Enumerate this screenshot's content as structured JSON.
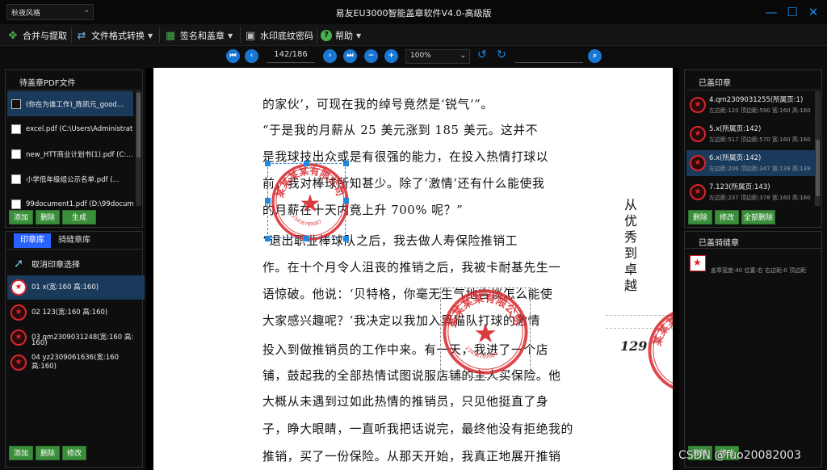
{
  "window": {
    "title": "易友EU3000智能盖章软件V4.0-高级版",
    "theme": "秋夜风格",
    "minimize": "—",
    "maximize": "☐",
    "close": "✕"
  },
  "toolbar": {
    "merge": "合并与提取",
    "convert": "文件格式转换",
    "sign": "签名和盖章",
    "watermark": "水印底纹密码",
    "help": "帮助"
  },
  "nav": {
    "page": "142/186",
    "zoom": "100%",
    "search_placeholder": ""
  },
  "left_panel": {
    "title": "待盖章PDF文件",
    "files": [
      {
        "name": "(你在为谁工作)_陈凯元_good...",
        "checked": false,
        "selected": true
      },
      {
        "name": "excel.pdf (C:\\Users\\Administrat...",
        "checked": false,
        "selected": false
      },
      {
        "name": "new_HTT商业计划书(1).pdf (C:...",
        "checked": false,
        "selected": false
      },
      {
        "name": "小学低年级组公示名单.pdf (...",
        "checked": false,
        "selected": false
      },
      {
        "name": "99document1.pdf (D:\\99docum...",
        "checked": false,
        "selected": false
      }
    ],
    "buttons": {
      "add": "添加",
      "delete": "删除",
      "generate": "生成"
    }
  },
  "stamp_lib": {
    "tabs": [
      "印章库",
      "骑缝章库"
    ],
    "cancel": "取消印章选择",
    "items": [
      {
        "name": "01 x(宽:160 高:160)",
        "selected": true
      },
      {
        "name": "02 123(宽:160 高:160)",
        "selected": false
      },
      {
        "name": "03 qm2309031248(宽:160 高:",
        "name2": "160)",
        "selected": false
      },
      {
        "name": "04 yz2309061636(宽:160 高:160)",
        "selected": false
      }
    ],
    "buttons": {
      "add": "添加",
      "delete": "删除",
      "edit": "修改"
    }
  },
  "document": {
    "lines": [
      "的家伙’，可现在我的绰号竟然是‘锐气’”。",
      "“于是我的月薪从 25 美元涨到 185 美元。这并不",
      "是我球技出众或是有很强的能力，在投入热情打球以",
      "前，我对棒球所知甚少。除了‘激情’还有什么能使我",
      "的月薪在十天内竟上升 700% 呢？”",
      "“退出职业棒球队之后，我去做人寿保险推销工",
      "作。在十个月令人沮丧的推销之后，我被卡耐基先生一",
      "语惊破。他说：‘贝特格，你毫无生气地言谈怎么能使",
      "大家感兴趣呢？’我决定以我加入黑猫队打球的激情",
      "投入到做推销员的工作中来。有一天，我进了一个店",
      "铺，鼓起我的全部热情试图说服店铺的主人买保险。他",
      "大概从未遇到过如此热情的推销员，只见他挺直了身",
      "子，睁大眼睛，一直听我把话说完，最终他没有拒绝我的",
      "推销，买了一份保险。从那天开始，我真正地展开推销"
    ],
    "side_heading": "从优秀到卓越",
    "page_number": "129",
    "stamp_text": "某某某某有限公司",
    "stamp_code": "23456789987"
  },
  "right_panel": {
    "title": "已盖印章",
    "items": [
      {
        "title": "4.qm2309031255(所属页:1)",
        "sub": "左边距:120 顶边距:590 宽:160 高:160",
        "selected": false
      },
      {
        "title": "5.x(所属页:142)",
        "sub": "左边距:517 顶边距:570 宽:160 高:160",
        "selected": false
      },
      {
        "title": "6.x(所属页:142)",
        "sub": "左边距:206 顶边距:347 宽:139 高:139",
        "selected": true
      },
      {
        "title": "7.123(所属页:143)",
        "sub": "左边距:237 顶边距:378 宽:160 高:160",
        "selected": false
      }
    ],
    "buttons": {
      "delete": "删除",
      "edit": "修改",
      "delete_all": "全部删除"
    },
    "seam_title": "已盖骑缝章",
    "seam_item": "盖章宽度:40 位置:右 右边距:0 顶边距",
    "seam_buttons": {
      "delete": "删除",
      "edit": "修改"
    }
  },
  "watermark_text": "CSDN @fuo20082003",
  "colors": {
    "accent": "#1976d2",
    "green": "#3a8f3a",
    "stamp_red": "#d9262c"
  }
}
